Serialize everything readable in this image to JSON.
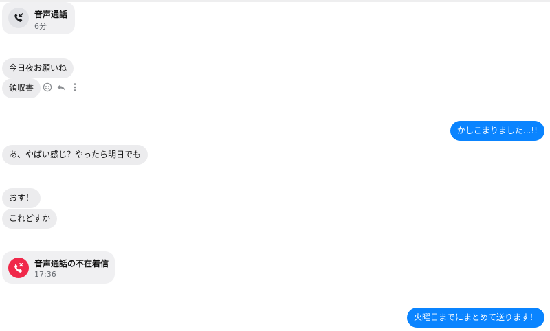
{
  "messages": {
    "voice_call": {
      "title": "音声通話",
      "duration": "6分"
    },
    "incoming_1": "今日夜お願いね",
    "incoming_2": "領収書",
    "outgoing_1": "かしこまりました...!!",
    "incoming_3": "あ、やばい感じ？やったら明日でも",
    "incoming_4": "おす！",
    "incoming_5": "これどすか",
    "missed_call": {
      "title": "音声通話の不在着信",
      "time": "17:36"
    },
    "outgoing_2": "火曜日までにまとめて送ります！"
  },
  "message_actions": {
    "icons": [
      "emoji-reaction-icon",
      "reply-icon",
      "more-options-icon"
    ]
  },
  "colors": {
    "outgoing_bubble": "#0a84ff",
    "incoming_bubble": "#ececee",
    "missed_call_icon": "#f0284a"
  }
}
